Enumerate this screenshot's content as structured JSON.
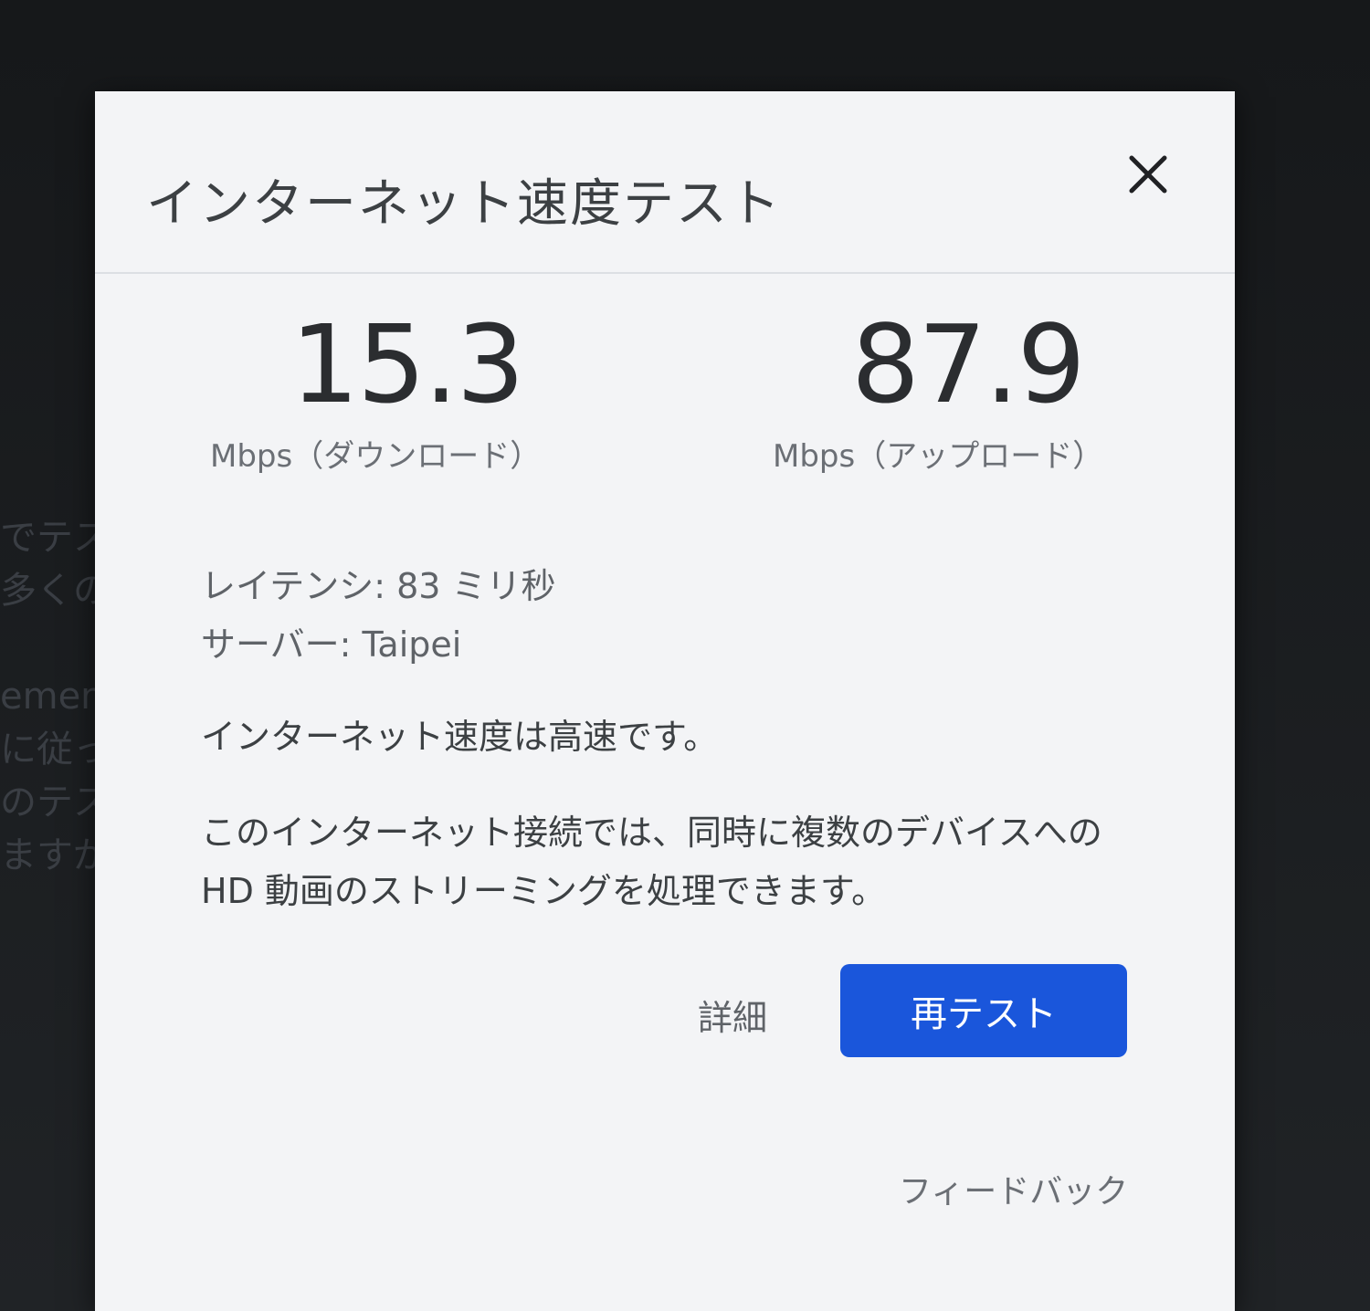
{
  "background": {
    "snippets": [
      "でテス",
      "多くの",
      "ement",
      "に従っ",
      "のテス",
      "ますが"
    ]
  },
  "dialog": {
    "title": "インターネット速度テスト",
    "close_icon": "close-icon"
  },
  "download": {
    "value": "15.3",
    "label": "Mbps（ダウンロード）"
  },
  "upload": {
    "value": "87.9",
    "label": "Mbps（アップロード）"
  },
  "info": {
    "latency": "レイテンシ: 83 ミリ秒",
    "server": "サーバー: Taipei"
  },
  "summary": "インターネット速度は高速です。",
  "description": "このインターネット接続では、同時に複数のデバイスへの HD 動画のストリーミングを処理できます。",
  "actions": {
    "details_label": "詳細",
    "retest_label": "再テスト",
    "feedback_label": "フィードバック"
  },
  "colors": {
    "primary_button": "#1a56db",
    "dialog_background": "#f3f4f6"
  }
}
